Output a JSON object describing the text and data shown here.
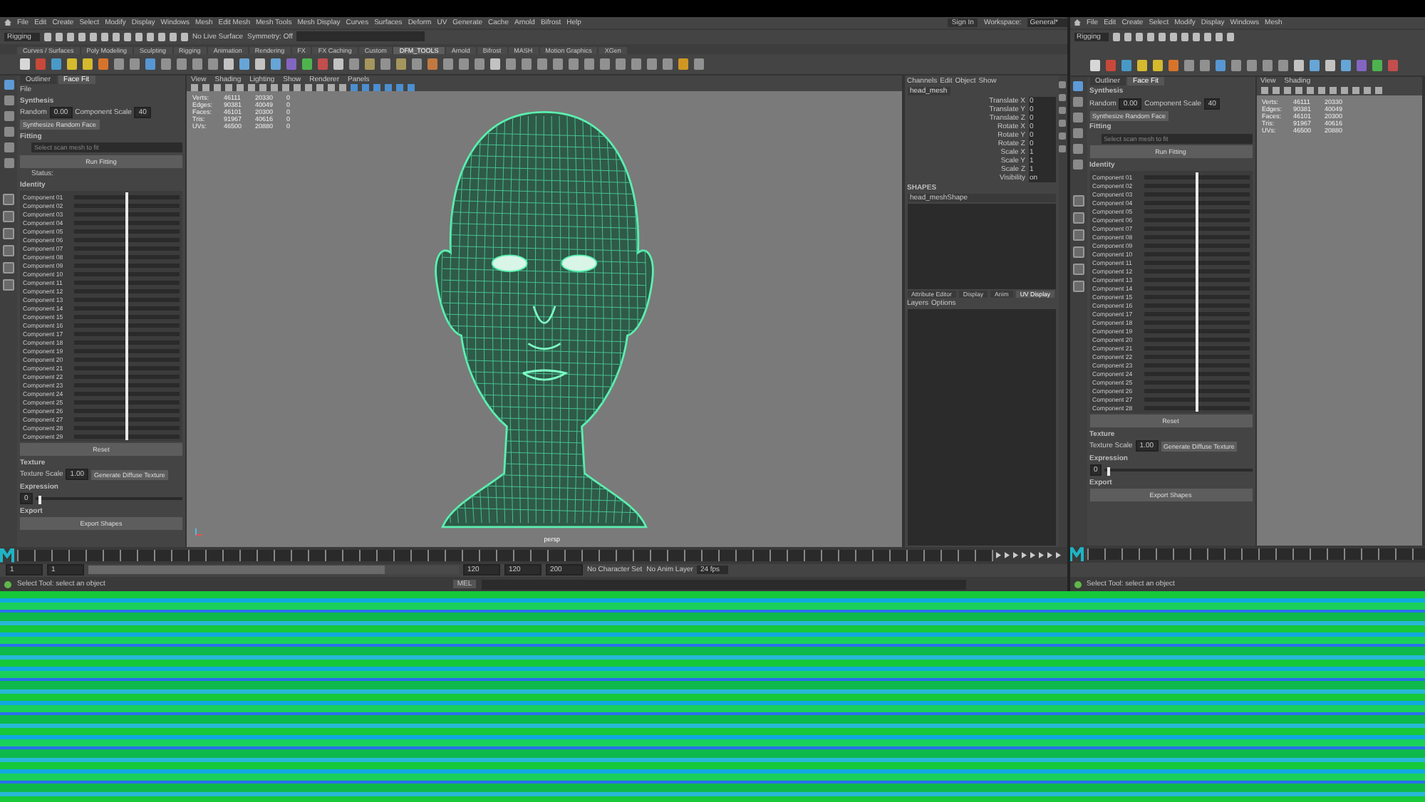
{
  "main_window": {
    "menus": [
      "File",
      "Edit",
      "Create",
      "Select",
      "Modify",
      "Display",
      "Windows",
      "Mesh",
      "Edit Mesh",
      "Mesh Tools",
      "Mesh Display",
      "Curves",
      "Surfaces",
      "Deform",
      "UV",
      "Generate",
      "Cache",
      "Arnold",
      "Bifrost",
      "Help"
    ],
    "mode": "Rigging",
    "symmetry": "Symmetry: Off",
    "live_surface": "No Live Surface",
    "workspace_label": "Workspace:",
    "workspace": "General*",
    "login": "Sign In",
    "shelf_tabs": [
      {
        "label": "Curves / Surfaces",
        "selected": false
      },
      {
        "label": "Poly Modeling",
        "selected": false
      },
      {
        "label": "Sculpting",
        "selected": false
      },
      {
        "label": "Rigging",
        "selected": false
      },
      {
        "label": "Animation",
        "selected": false
      },
      {
        "label": "Rendering",
        "selected": false
      },
      {
        "label": "FX",
        "selected": false
      },
      {
        "label": "FX Caching",
        "selected": false
      },
      {
        "label": "Custom",
        "selected": false
      },
      {
        "label": "DFM_TOOLS",
        "selected": true
      },
      {
        "label": "Arnold",
        "selected": false
      },
      {
        "label": "Bifrost",
        "selected": false
      },
      {
        "label": "MASH",
        "selected": false
      },
      {
        "label": "Motion Graphics",
        "selected": false
      },
      {
        "label": "XGen",
        "selected": false
      }
    ],
    "panel": {
      "tabs": [
        {
          "label": "Outliner",
          "selected": false
        },
        {
          "label": "Face Fit",
          "selected": true
        }
      ],
      "file_label": "File",
      "synthesis_title": "Synthesis",
      "seed_label": "Random",
      "seed": "0.00",
      "count_label": "Component Scale",
      "count": "40",
      "synthesize_button": "Synthesize Random Face",
      "fitting_title": "Fitting",
      "scan_placeholder": "Select scan mesh to fit",
      "run_button": "Run Fitting",
      "status": "Status:",
      "identity_title": "Identity",
      "components": [
        {
          "label": "Component 01",
          "level": 0.5
        },
        {
          "label": "Component 02",
          "level": 0.5
        },
        {
          "label": "Component 03",
          "level": 0.5
        },
        {
          "label": "Component 04",
          "level": 0.5
        },
        {
          "label": "Component 05",
          "level": 0.5
        },
        {
          "label": "Component 06",
          "level": 0.5
        },
        {
          "label": "Component 07",
          "level": 0.5
        },
        {
          "label": "Component 08",
          "level": 0.5
        },
        {
          "label": "Component 09",
          "level": 0.5
        },
        {
          "label": "Component 10",
          "level": 0.5
        },
        {
          "label": "Component 11",
          "level": 0.5
        },
        {
          "label": "Component 12",
          "level": 0.5
        },
        {
          "label": "Component 13",
          "level": 0.5
        },
        {
          "label": "Component 14",
          "level": 0.5
        },
        {
          "label": "Component 15",
          "level": 0.5
        },
        {
          "label": "Component 16",
          "level": 0.5
        },
        {
          "label": "Component 17",
          "level": 0.5
        },
        {
          "label": "Component 18",
          "level": 0.5
        },
        {
          "label": "Component 19",
          "level": 0.5
        },
        {
          "label": "Component 20",
          "level": 0.5
        },
        {
          "label": "Component 21",
          "level": 0.5
        },
        {
          "label": "Component 22",
          "level": 0.5
        },
        {
          "label": "Component 23",
          "level": 0.5
        },
        {
          "label": "Component 24",
          "level": 0.5
        },
        {
          "label": "Component 25",
          "level": 0.5
        },
        {
          "label": "Component 26",
          "level": 0.5
        },
        {
          "label": "Component 27",
          "level": 0.5
        },
        {
          "label": "Component 28",
          "level": 0.5
        },
        {
          "label": "Component 29",
          "level": 0.5
        }
      ],
      "reset_button": "Reset",
      "texture_title": "Texture",
      "texture_scale_label": "Texture Scale",
      "texture_scale": "1.00",
      "texture_button": "Generate Diffuse Texture",
      "expression_title": "Expression",
      "expression": {
        "value": "0",
        "level": 0.02
      },
      "export_title": "Export",
      "export_button": "Export Shapes"
    },
    "viewport": {
      "menus": [
        "View",
        "Shading",
        "Lighting",
        "Show",
        "Renderer",
        "Panels"
      ],
      "stats": [
        [
          "Verts:",
          "46111",
          "20330",
          "0"
        ],
        [
          "Edges:",
          "90381",
          "40049",
          "0"
        ],
        [
          "Faces:",
          "46101",
          "20300",
          "0"
        ],
        [
          "Tris:",
          "91967",
          "40616",
          "0"
        ],
        [
          "UVs:",
          "46500",
          "20880",
          "0"
        ]
      ],
      "camera": "persp"
    },
    "channel_box": {
      "tabs": [
        "Channels",
        "Edit",
        "Object",
        "Show"
      ],
      "object": "head_mesh",
      "attributes": [
        [
          "Translate X",
          "0"
        ],
        [
          "Translate Y",
          "0"
        ],
        [
          "Translate Z",
          "0"
        ],
        [
          "Rotate X",
          "0"
        ],
        [
          "Rotate Y",
          "0"
        ],
        [
          "Rotate Z",
          "0"
        ],
        [
          "Scale X",
          "1"
        ],
        [
          "Scale Y",
          "1"
        ],
        [
          "Scale Z",
          "1"
        ],
        [
          "Visibility",
          "on"
        ]
      ],
      "shapes_title": "SHAPES",
      "shape": "head_meshShape",
      "layer_tabs": [
        {
          "label": "Attribute Editor",
          "selected": false
        },
        {
          "label": "Display",
          "selected": false
        },
        {
          "label": "Anim",
          "selected": false
        },
        {
          "label": "UV Display",
          "selected": true
        }
      ],
      "layer_menus": [
        "Layers",
        "Options"
      ]
    },
    "time_range": [
      "1",
      "1",
      "120",
      "120",
      "200"
    ],
    "range_slider": {
      "level": 0.8
    },
    "character": "No Character Set",
    "anim_layer": "No Anim Layer",
    "fps": "24 fps",
    "command_label": "MEL",
    "help_line": "Select Tool: select an object"
  },
  "second_window": {
    "menus": [
      "File",
      "Edit",
      "Create",
      "Select",
      "Modify",
      "Display",
      "Windows",
      "Mesh"
    ],
    "mode": "Rigging",
    "panel": {
      "tabs": [
        {
          "label": "Outliner",
          "selected": false
        },
        {
          "label": "Face Fit",
          "selected": true
        }
      ],
      "synthesis_title": "Synthesis",
      "seed_label": "Random",
      "seed": "0.00",
      "count_label": "Component Scale",
      "count": "40",
      "synthesize_button": "Synthesize Random Face",
      "fitting_title": "Fitting",
      "scan_placeholder": "Select scan mesh to fit",
      "run_button": "Run Fitting",
      "identity_title": "Identity",
      "components": [
        {
          "label": "Component 01",
          "level": 0.5
        },
        {
          "label": "Component 02",
          "level": 0.5
        },
        {
          "label": "Component 03",
          "level": 0.5
        },
        {
          "label": "Component 04",
          "level": 0.5
        },
        {
          "label": "Component 05",
          "level": 0.5
        },
        {
          "label": "Component 06",
          "level": 0.5
        },
        {
          "label": "Component 07",
          "level": 0.5
        },
        {
          "label": "Component 08",
          "level": 0.5
        },
        {
          "label": "Component 09",
          "level": 0.5
        },
        {
          "label": "Component 10",
          "level": 0.5
        },
        {
          "label": "Component 11",
          "level": 0.5
        },
        {
          "label": "Component 12",
          "level": 0.5
        },
        {
          "label": "Component 13",
          "level": 0.5
        },
        {
          "label": "Component 14",
          "level": 0.5
        },
        {
          "label": "Component 15",
          "level": 0.5
        },
        {
          "label": "Component 16",
          "level": 0.5
        },
        {
          "label": "Component 17",
          "level": 0.5
        },
        {
          "label": "Component 18",
          "level": 0.5
        },
        {
          "label": "Component 19",
          "level": 0.5
        },
        {
          "label": "Component 20",
          "level": 0.5
        },
        {
          "label": "Component 21",
          "level": 0.5
        },
        {
          "label": "Component 22",
          "level": 0.5
        },
        {
          "label": "Component 23",
          "level": 0.5
        },
        {
          "label": "Component 24",
          "level": 0.5
        },
        {
          "label": "Component 25",
          "level": 0.5
        },
        {
          "label": "Component 26",
          "level": 0.5
        },
        {
          "label": "Component 27",
          "level": 0.5
        },
        {
          "label": "Component 28",
          "level": 0.5
        }
      ],
      "reset_button": "Reset",
      "texture_title": "Texture",
      "texture_scale_label": "Texture Scale",
      "texture_scale": "1.00",
      "texture_button": "Generate Diffuse Texture",
      "expression_title": "Expression",
      "expression": {
        "value": "0",
        "level": 0.02
      },
      "export_title": "Export",
      "export_button": "Export Shapes"
    },
    "viewport": {
      "menus": [
        "View",
        "Shading"
      ],
      "stats": [
        [
          "Verts:",
          "46111",
          "20330"
        ],
        [
          "Edges:",
          "90381",
          "40049"
        ],
        [
          "Faces:",
          "46101",
          "20300"
        ],
        [
          "Tris:",
          "91967",
          "40616"
        ],
        [
          "UVs:",
          "46500",
          "20880"
        ]
      ]
    },
    "help_line": "Select Tool: select an object"
  }
}
